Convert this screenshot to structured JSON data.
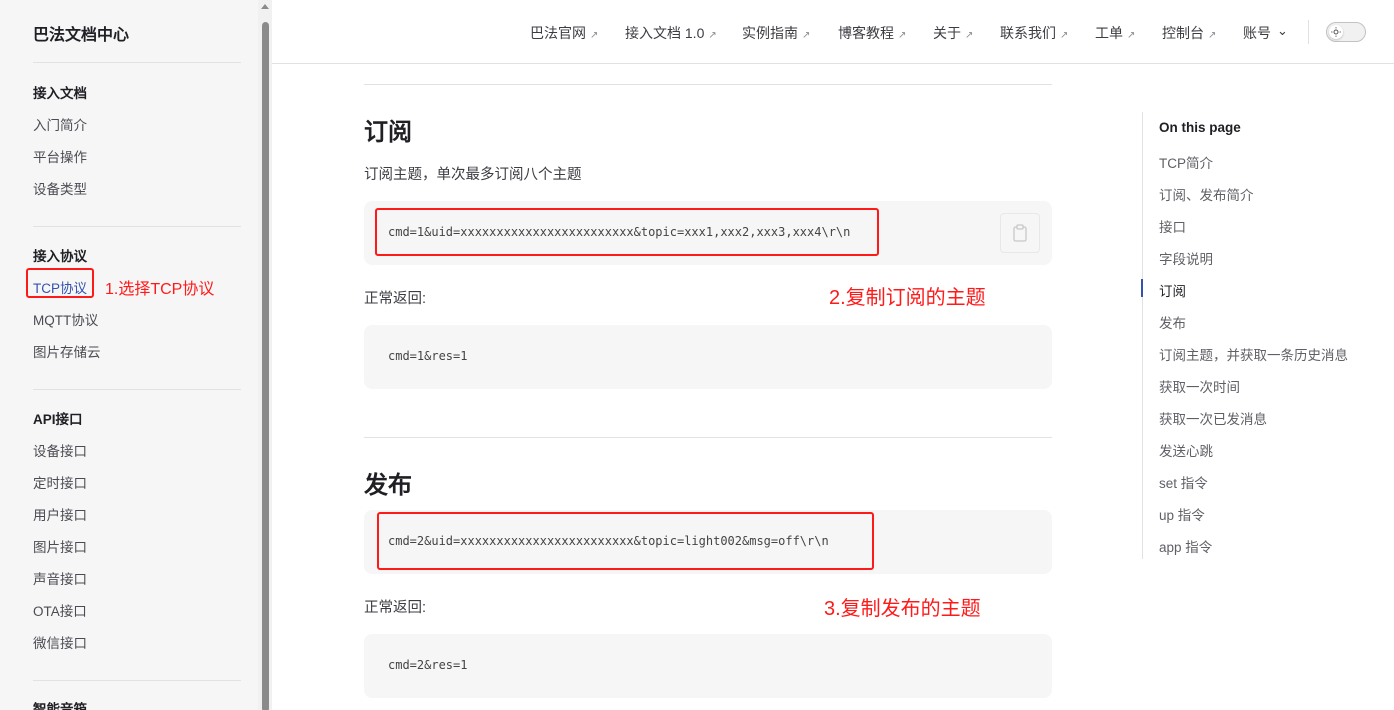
{
  "sidebar": {
    "brand": "巴法文档中心",
    "groups": [
      {
        "title": "接入文档",
        "items": [
          "入门简介",
          "平台操作",
          "设备类型"
        ]
      },
      {
        "title": "接入协议",
        "items": [
          "TCP协议",
          "MQTT协议",
          "图片存储云"
        ]
      },
      {
        "title": "API接口",
        "items": [
          "设备接口",
          "定时接口",
          "用户接口",
          "图片接口",
          "声音接口",
          "OTA接口",
          "微信接口"
        ]
      },
      {
        "title": "智能音箱",
        "items": []
      }
    ],
    "active_item": "TCP协议"
  },
  "nav": {
    "items": [
      "巴法官网",
      "接入文档 1.0",
      "实例指南",
      "博客教程",
      "关于",
      "联系我们",
      "工单",
      "控制台"
    ],
    "ext_glyph": "↗",
    "account": "账号",
    "account_chevron": "⌄"
  },
  "content": {
    "sections": [
      {
        "heading": "订阅",
        "description": "订阅主题，单次最多订阅八个主题",
        "code": "cmd=1&uid=xxxxxxxxxxxxxxxxxxxxxxxx&topic=xxx1,xxx2,xxx3,xxx4\\r\\n",
        "return_label": "正常返回:",
        "return_code": "cmd=1&res=1"
      },
      {
        "heading": "发布",
        "code": "cmd=2&uid=xxxxxxxxxxxxxxxxxxxxxxxx&topic=light002&msg=off\\r\\n",
        "return_label": "正常返回:",
        "return_code": "cmd=2&res=1"
      }
    ]
  },
  "annotations": {
    "step1": "1.选择TCP协议",
    "step2": "2.复制订阅的主题",
    "step3": "3.复制发布的主题",
    "color": "#ff1a1a"
  },
  "outline": {
    "title": "On this page",
    "items": [
      "TCP简介",
      "订阅、发布简介",
      "接口",
      "字段说明",
      "订阅",
      "发布",
      "订阅主题，并获取一条历史消息",
      "获取一次时间",
      "获取一次已发消息",
      "发送心跳",
      "set 指令",
      "up 指令",
      "app 指令"
    ],
    "active": "订阅"
  },
  "colors": {
    "accent": "#3451b2",
    "sidebar_bg": "#f6f6f7",
    "code_bg": "#f6f6f7"
  }
}
